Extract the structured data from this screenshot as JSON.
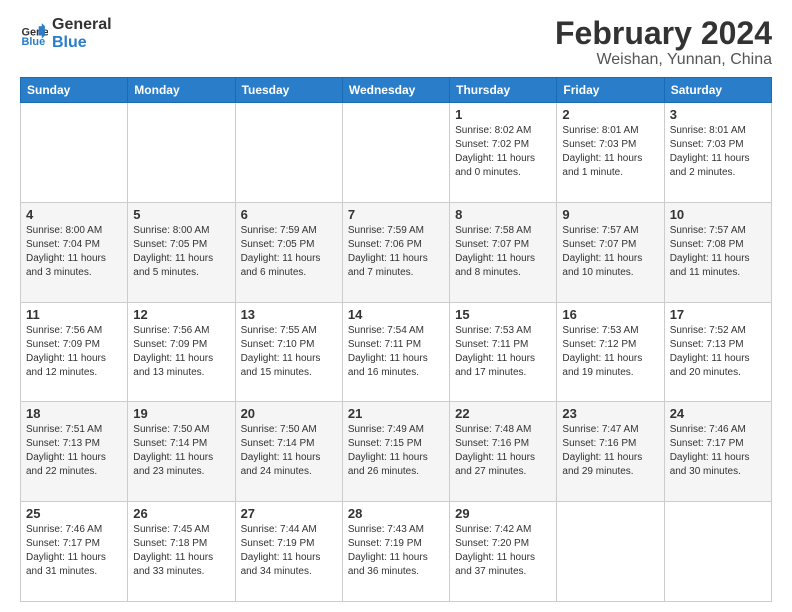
{
  "header": {
    "logo_general": "General",
    "logo_blue": "Blue",
    "main_title": "February 2024",
    "subtitle": "Weishan, Yunnan, China"
  },
  "days_of_week": [
    "Sunday",
    "Monday",
    "Tuesday",
    "Wednesday",
    "Thursday",
    "Friday",
    "Saturday"
  ],
  "weeks": [
    [
      {
        "day": "",
        "info": ""
      },
      {
        "day": "",
        "info": ""
      },
      {
        "day": "",
        "info": ""
      },
      {
        "day": "",
        "info": ""
      },
      {
        "day": "1",
        "info": "Sunrise: 8:02 AM\nSunset: 7:02 PM\nDaylight: 11 hours\nand 0 minutes."
      },
      {
        "day": "2",
        "info": "Sunrise: 8:01 AM\nSunset: 7:03 PM\nDaylight: 11 hours\nand 1 minute."
      },
      {
        "day": "3",
        "info": "Sunrise: 8:01 AM\nSunset: 7:03 PM\nDaylight: 11 hours\nand 2 minutes."
      }
    ],
    [
      {
        "day": "4",
        "info": "Sunrise: 8:00 AM\nSunset: 7:04 PM\nDaylight: 11 hours\nand 3 minutes."
      },
      {
        "day": "5",
        "info": "Sunrise: 8:00 AM\nSunset: 7:05 PM\nDaylight: 11 hours\nand 5 minutes."
      },
      {
        "day": "6",
        "info": "Sunrise: 7:59 AM\nSunset: 7:05 PM\nDaylight: 11 hours\nand 6 minutes."
      },
      {
        "day": "7",
        "info": "Sunrise: 7:59 AM\nSunset: 7:06 PM\nDaylight: 11 hours\nand 7 minutes."
      },
      {
        "day": "8",
        "info": "Sunrise: 7:58 AM\nSunset: 7:07 PM\nDaylight: 11 hours\nand 8 minutes."
      },
      {
        "day": "9",
        "info": "Sunrise: 7:57 AM\nSunset: 7:07 PM\nDaylight: 11 hours\nand 10 minutes."
      },
      {
        "day": "10",
        "info": "Sunrise: 7:57 AM\nSunset: 7:08 PM\nDaylight: 11 hours\nand 11 minutes."
      }
    ],
    [
      {
        "day": "11",
        "info": "Sunrise: 7:56 AM\nSunset: 7:09 PM\nDaylight: 11 hours\nand 12 minutes."
      },
      {
        "day": "12",
        "info": "Sunrise: 7:56 AM\nSunset: 7:09 PM\nDaylight: 11 hours\nand 13 minutes."
      },
      {
        "day": "13",
        "info": "Sunrise: 7:55 AM\nSunset: 7:10 PM\nDaylight: 11 hours\nand 15 minutes."
      },
      {
        "day": "14",
        "info": "Sunrise: 7:54 AM\nSunset: 7:11 PM\nDaylight: 11 hours\nand 16 minutes."
      },
      {
        "day": "15",
        "info": "Sunrise: 7:53 AM\nSunset: 7:11 PM\nDaylight: 11 hours\nand 17 minutes."
      },
      {
        "day": "16",
        "info": "Sunrise: 7:53 AM\nSunset: 7:12 PM\nDaylight: 11 hours\nand 19 minutes."
      },
      {
        "day": "17",
        "info": "Sunrise: 7:52 AM\nSunset: 7:13 PM\nDaylight: 11 hours\nand 20 minutes."
      }
    ],
    [
      {
        "day": "18",
        "info": "Sunrise: 7:51 AM\nSunset: 7:13 PM\nDaylight: 11 hours\nand 22 minutes."
      },
      {
        "day": "19",
        "info": "Sunrise: 7:50 AM\nSunset: 7:14 PM\nDaylight: 11 hours\nand 23 minutes."
      },
      {
        "day": "20",
        "info": "Sunrise: 7:50 AM\nSunset: 7:14 PM\nDaylight: 11 hours\nand 24 minutes."
      },
      {
        "day": "21",
        "info": "Sunrise: 7:49 AM\nSunset: 7:15 PM\nDaylight: 11 hours\nand 26 minutes."
      },
      {
        "day": "22",
        "info": "Sunrise: 7:48 AM\nSunset: 7:16 PM\nDaylight: 11 hours\nand 27 minutes."
      },
      {
        "day": "23",
        "info": "Sunrise: 7:47 AM\nSunset: 7:16 PM\nDaylight: 11 hours\nand 29 minutes."
      },
      {
        "day": "24",
        "info": "Sunrise: 7:46 AM\nSunset: 7:17 PM\nDaylight: 11 hours\nand 30 minutes."
      }
    ],
    [
      {
        "day": "25",
        "info": "Sunrise: 7:46 AM\nSunset: 7:17 PM\nDaylight: 11 hours\nand 31 minutes."
      },
      {
        "day": "26",
        "info": "Sunrise: 7:45 AM\nSunset: 7:18 PM\nDaylight: 11 hours\nand 33 minutes."
      },
      {
        "day": "27",
        "info": "Sunrise: 7:44 AM\nSunset: 7:19 PM\nDaylight: 11 hours\nand 34 minutes."
      },
      {
        "day": "28",
        "info": "Sunrise: 7:43 AM\nSunset: 7:19 PM\nDaylight: 11 hours\nand 36 minutes."
      },
      {
        "day": "29",
        "info": "Sunrise: 7:42 AM\nSunset: 7:20 PM\nDaylight: 11 hours\nand 37 minutes."
      },
      {
        "day": "",
        "info": ""
      },
      {
        "day": "",
        "info": ""
      }
    ]
  ]
}
